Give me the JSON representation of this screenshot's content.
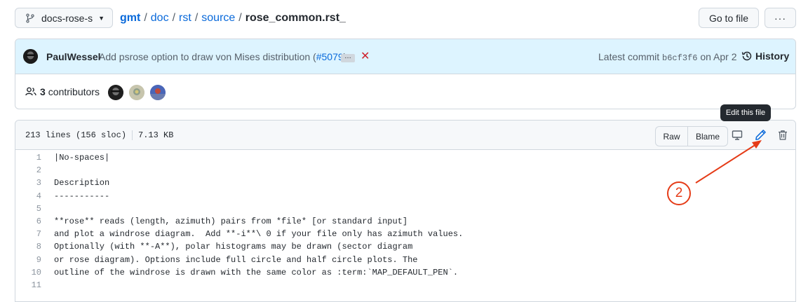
{
  "topbar": {
    "branch": "docs-rose-s",
    "breadcrumb": [
      {
        "label": "gmt"
      },
      {
        "label": "doc"
      },
      {
        "label": "rst"
      },
      {
        "label": "source"
      }
    ],
    "filename": "rose_common.rst_",
    "goto_label": "Go to file",
    "more_label": "···"
  },
  "commit": {
    "author": "PaulWessel",
    "message": "Add psrose option to draw von Mises distribution (",
    "pr_link": "#5079",
    "message_end": ")",
    "ellipsis": "…",
    "status": "✕",
    "latest_prefix": "Latest commit",
    "sha": "b6cf3f6",
    "date": "on Apr 2",
    "history_label": "History"
  },
  "contributors": {
    "count": "3",
    "label": "contributors"
  },
  "file": {
    "lines_info": "213 lines (156 sloc)",
    "size": "7.13 KB",
    "raw_label": "Raw",
    "blame_label": "Blame",
    "tooltip": "Edit this file"
  },
  "code": [
    {
      "n": "1",
      "text": "|No-spaces|"
    },
    {
      "n": "2",
      "text": ""
    },
    {
      "n": "3",
      "text": "Description"
    },
    {
      "n": "4",
      "text": "-----------"
    },
    {
      "n": "5",
      "text": ""
    },
    {
      "n": "6",
      "text": "**rose** reads (length, azimuth) pairs from *file* [or standard input]"
    },
    {
      "n": "7",
      "text": "and plot a windrose diagram.  Add **-i**\\ 0 if your file only has azimuth values."
    },
    {
      "n": "8",
      "text": "Optionally (with **-A**), polar histograms may be drawn (sector diagram"
    },
    {
      "n": "9",
      "text": "or rose diagram). Options include full circle and half circle plots. The"
    },
    {
      "n": "10",
      "text": "outline of the windrose is drawn with the same color as :term:`MAP_DEFAULT_PEN`."
    },
    {
      "n": "11",
      "text": ""
    }
  ],
  "annotation": {
    "number": "2",
    "color": "#e53b17"
  },
  "colors": {
    "link": "#0969da",
    "commit_bg": "#ddf4ff",
    "border": "#d0d7de"
  }
}
